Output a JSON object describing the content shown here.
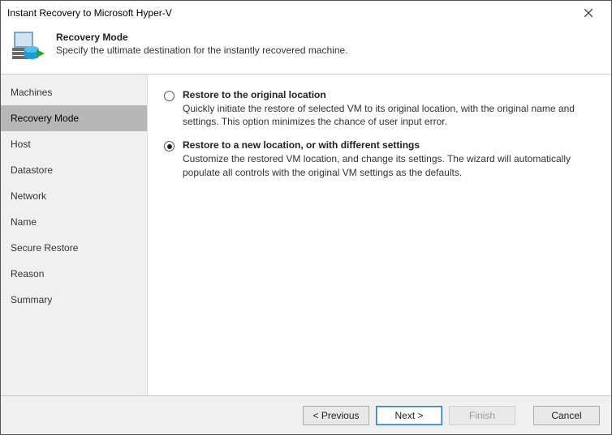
{
  "window": {
    "title": "Instant Recovery to Microsoft Hyper-V"
  },
  "header": {
    "title": "Recovery Mode",
    "subtitle": "Specify the ultimate destination for the instantly recovered machine."
  },
  "sidebar": {
    "items": [
      {
        "label": "Machines"
      },
      {
        "label": "Recovery Mode"
      },
      {
        "label": "Host"
      },
      {
        "label": "Datastore"
      },
      {
        "label": "Network"
      },
      {
        "label": "Name"
      },
      {
        "label": "Secure Restore"
      },
      {
        "label": "Reason"
      },
      {
        "label": "Summary"
      }
    ],
    "active_index": 1
  },
  "options": [
    {
      "title": "Restore to the original location",
      "desc": "Quickly initiate the restore of selected VM to its original location, with the original name and settings. This option minimizes the chance of user input error.",
      "checked": false
    },
    {
      "title": "Restore to a new location, or with different settings",
      "desc": "Customize the restored VM location, and change its settings. The wizard will automatically populate all controls with the original VM settings as the defaults.",
      "checked": true
    }
  ],
  "footer": {
    "previous": "< Previous",
    "next": "Next >",
    "finish": "Finish",
    "cancel": "Cancel"
  }
}
